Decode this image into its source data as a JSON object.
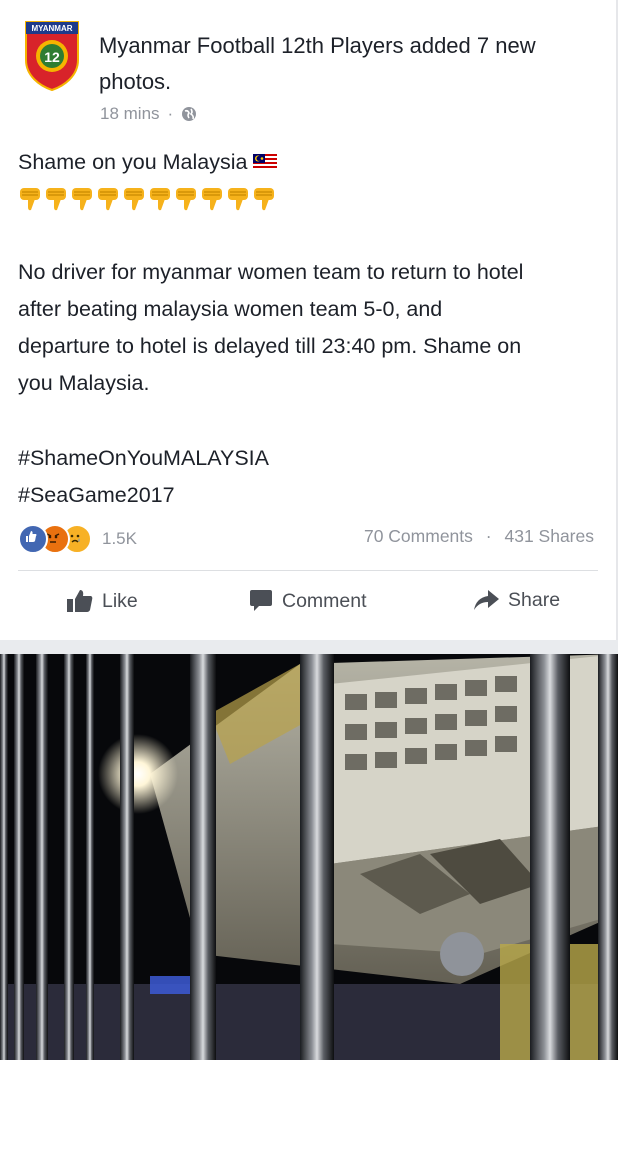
{
  "post": {
    "page_name": "Myanmar Football 12th Players",
    "action_text": "added 7 new",
    "action_text_2": "photos.",
    "time": "18 mins",
    "dot": "·",
    "privacy_icon": "globe-icon",
    "logo_text_top": "MYANMAR",
    "logo_number": "12",
    "line1": "Shame on you Malaysia",
    "thumbs_count": 10,
    "paragraph": [
      "No driver for myanmar women team to return to hotel",
      "after beating malaysia women team 5-0, and",
      "departure to hotel is delayed till 23:40 pm. Shame on",
      "you Malaysia."
    ],
    "hashtags": [
      "#ShameOnYouMALAYSIA",
      "#SeaGame2017"
    ]
  },
  "stats": {
    "reactions_count": "1.5K",
    "comments": "70 Comments",
    "separator": "·",
    "shares": "431 Shares"
  },
  "actions": {
    "like": "Like",
    "comment": "Comment",
    "share": "Share"
  },
  "colors": {
    "facebook_blue": "#4267b2",
    "meta_gray": "#90949c",
    "angry": "#e9710f",
    "sad": "#f7b125"
  }
}
